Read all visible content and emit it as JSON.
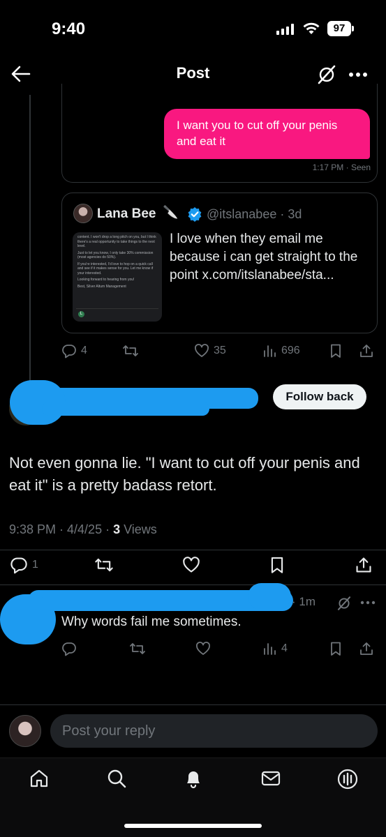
{
  "status_bar": {
    "time": "9:40",
    "battery": "97"
  },
  "header": {
    "title": "Post"
  },
  "dm": {
    "message": "I want you to cut off your penis and eat it",
    "meta": "1:17 PM · Seen"
  },
  "quote": {
    "name": "Lana Bee",
    "emoji": "🔪",
    "handle": "@itslanabee · 3d",
    "text": "I love when they email me because i can get straight to the point x.com/itslanabee/sta...",
    "thumb_lines": [
      "content. I won't drop a long pitch on you, but I think there's a real opportunity to take things to the next level.",
      "Just to let you know, I only take 30% commission (most agencies do 50%).",
      "If you're interested, I'd love to hop on a quick call and see if it makes sense for you. Let me know if your interested.",
      "Looking forward to hearing from you!",
      "Best, Silver Altum Management"
    ]
  },
  "quote_actions": {
    "replies": "4",
    "likes": "35",
    "views": "696"
  },
  "follow_button": "Follow back",
  "main_post": {
    "text": "Not even gonna lie. \"I want to cut off your penis and eat it\" is a pretty badass retort.",
    "time": "9:38 PM · 4/4/25 · ",
    "views_count": "3",
    "views_label": " Views"
  },
  "main_actions": {
    "replies": "1"
  },
  "reply": {
    "meta": "· 1m",
    "text": "Why words fail me sometimes.",
    "views": "4"
  },
  "composer": {
    "placeholder": "Post your reply"
  },
  "colors": {
    "accent": "#1d9bf0",
    "dm_bubble": "#f91880",
    "muted": "#71767b"
  }
}
